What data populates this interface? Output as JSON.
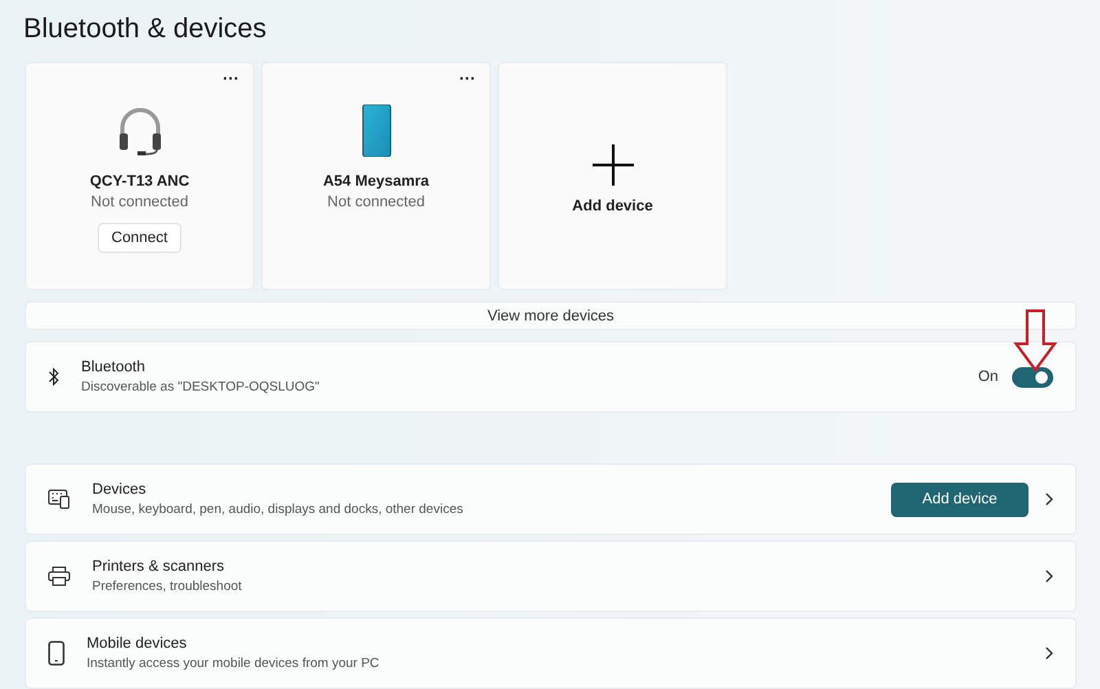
{
  "title": "Bluetooth & devices",
  "device_cards": [
    {
      "kind": "headset",
      "name": "QCY-T13 ANC",
      "status": "Not connected",
      "more": "···",
      "action": "Connect"
    },
    {
      "kind": "phone",
      "name": "A54 Meysamra",
      "status": "Not connected",
      "more": "···"
    },
    {
      "kind": "add",
      "name": "Add device"
    }
  ],
  "view_more": "View more devices",
  "bluetooth": {
    "title": "Bluetooth",
    "subtitle": "Discoverable as \"DESKTOP-OQSLUOG\"",
    "state_label": "On",
    "on": true
  },
  "settings_rows": [
    {
      "kind": "devices",
      "title": "Devices",
      "subtitle": "Mouse, keyboard, pen, audio, displays and docks, other devices",
      "button": "Add device"
    },
    {
      "kind": "printer",
      "title": "Printers & scanners",
      "subtitle": "Preferences, troubleshoot"
    },
    {
      "kind": "mobile",
      "title": "Mobile devices",
      "subtitle": "Instantly access your mobile devices from your PC"
    }
  ]
}
